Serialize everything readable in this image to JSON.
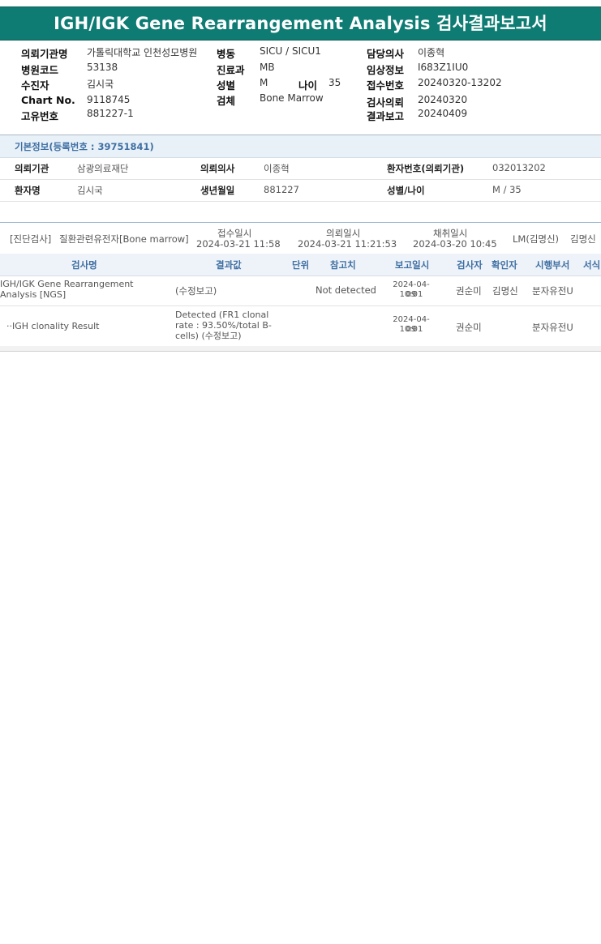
{
  "title": "IGH/IGK Gene Rearrangement Analysis 검사결과보고서",
  "header": {
    "col1": [
      {
        "label": "의뢰기관명",
        "value": "가톨릭대학교 인천성모병원"
      },
      {
        "label": "병원코드",
        "value": "53138"
      },
      {
        "label": "수진자",
        "value": "김시국"
      },
      {
        "label": "Chart No.",
        "value": "9118745"
      },
      {
        "label": "고유번호",
        "value": "881227-1"
      }
    ],
    "col2": [
      {
        "label": "병동",
        "value": "SICU / SICU1"
      },
      {
        "label": "진료과",
        "value": "MB"
      },
      {
        "label": "성별",
        "value": "M"
      },
      {
        "label": "검체",
        "value": "Bone Marrow"
      }
    ],
    "age": {
      "label": "나이",
      "value": "35"
    },
    "col3": [
      {
        "label": "담당의사",
        "value": "이종혁"
      },
      {
        "label": "임상정보",
        "value": "I683Z1IU0"
      },
      {
        "label": "접수번호",
        "value": "20240320-13202"
      },
      {
        "label": "검사의뢰",
        "value": "20240320"
      },
      {
        "label": "결과보고",
        "value": "20240409"
      }
    ]
  },
  "basic_info": {
    "heading": "기본정보(등록번호 : 39751841)",
    "row1": {
      "k1": "의뢰기관",
      "v1": "삼광의료재단",
      "k2": "의뢰의사",
      "v2": "이종혁",
      "k3": "환자번호(의뢰기관)",
      "v3": "032013202"
    },
    "row2": {
      "k1": "환자명",
      "v1": "김시국",
      "k2": "생년월일",
      "v2": "881227",
      "k3": "성별/나이",
      "v3": "M / 35"
    }
  },
  "order": {
    "category": "[진단검사]",
    "test": "질환관련유전자[Bone marrow]",
    "received_label": "접수일시",
    "received": "2024-03-21 11:58",
    "requested_label": "의뢰일시",
    "requested": "2024-03-21 11:21:53",
    "collected_label": "채취일시",
    "collected": "2024-03-20 10:45",
    "lab": "LM(김명신)",
    "doctor": "김명신"
  },
  "table": {
    "headers": [
      "검사명",
      "결과값",
      "단위",
      "참고치",
      "보고일시",
      "검사자",
      "확인자",
      "시행부서",
      "서식"
    ],
    "rows": [
      {
        "name": "IGH/IGK Gene Rearrangement Analysis [NGS]",
        "result": "(수정보고)",
        "unit": "",
        "reference": "Not detected",
        "report_date": "2024-04-09",
        "report_time": "10:01",
        "tester": "권순미",
        "confirmer": "김명신",
        "dept": "분자유전U"
      },
      {
        "name": "··IGH clonality Result",
        "result": "Detected (FR1 clonal rate : 93.50%/total B-cells) (수정보고)",
        "unit": "",
        "reference": "",
        "report_date": "2024-04-09",
        "report_time": "10:01",
        "tester": "권순미",
        "confirmer": "",
        "dept": "분자유전U"
      }
    ]
  },
  "colors": {
    "title_bg": "#0f7c74",
    "section_text": "#3f6fa3",
    "section_bg": "#e9f1f8"
  }
}
